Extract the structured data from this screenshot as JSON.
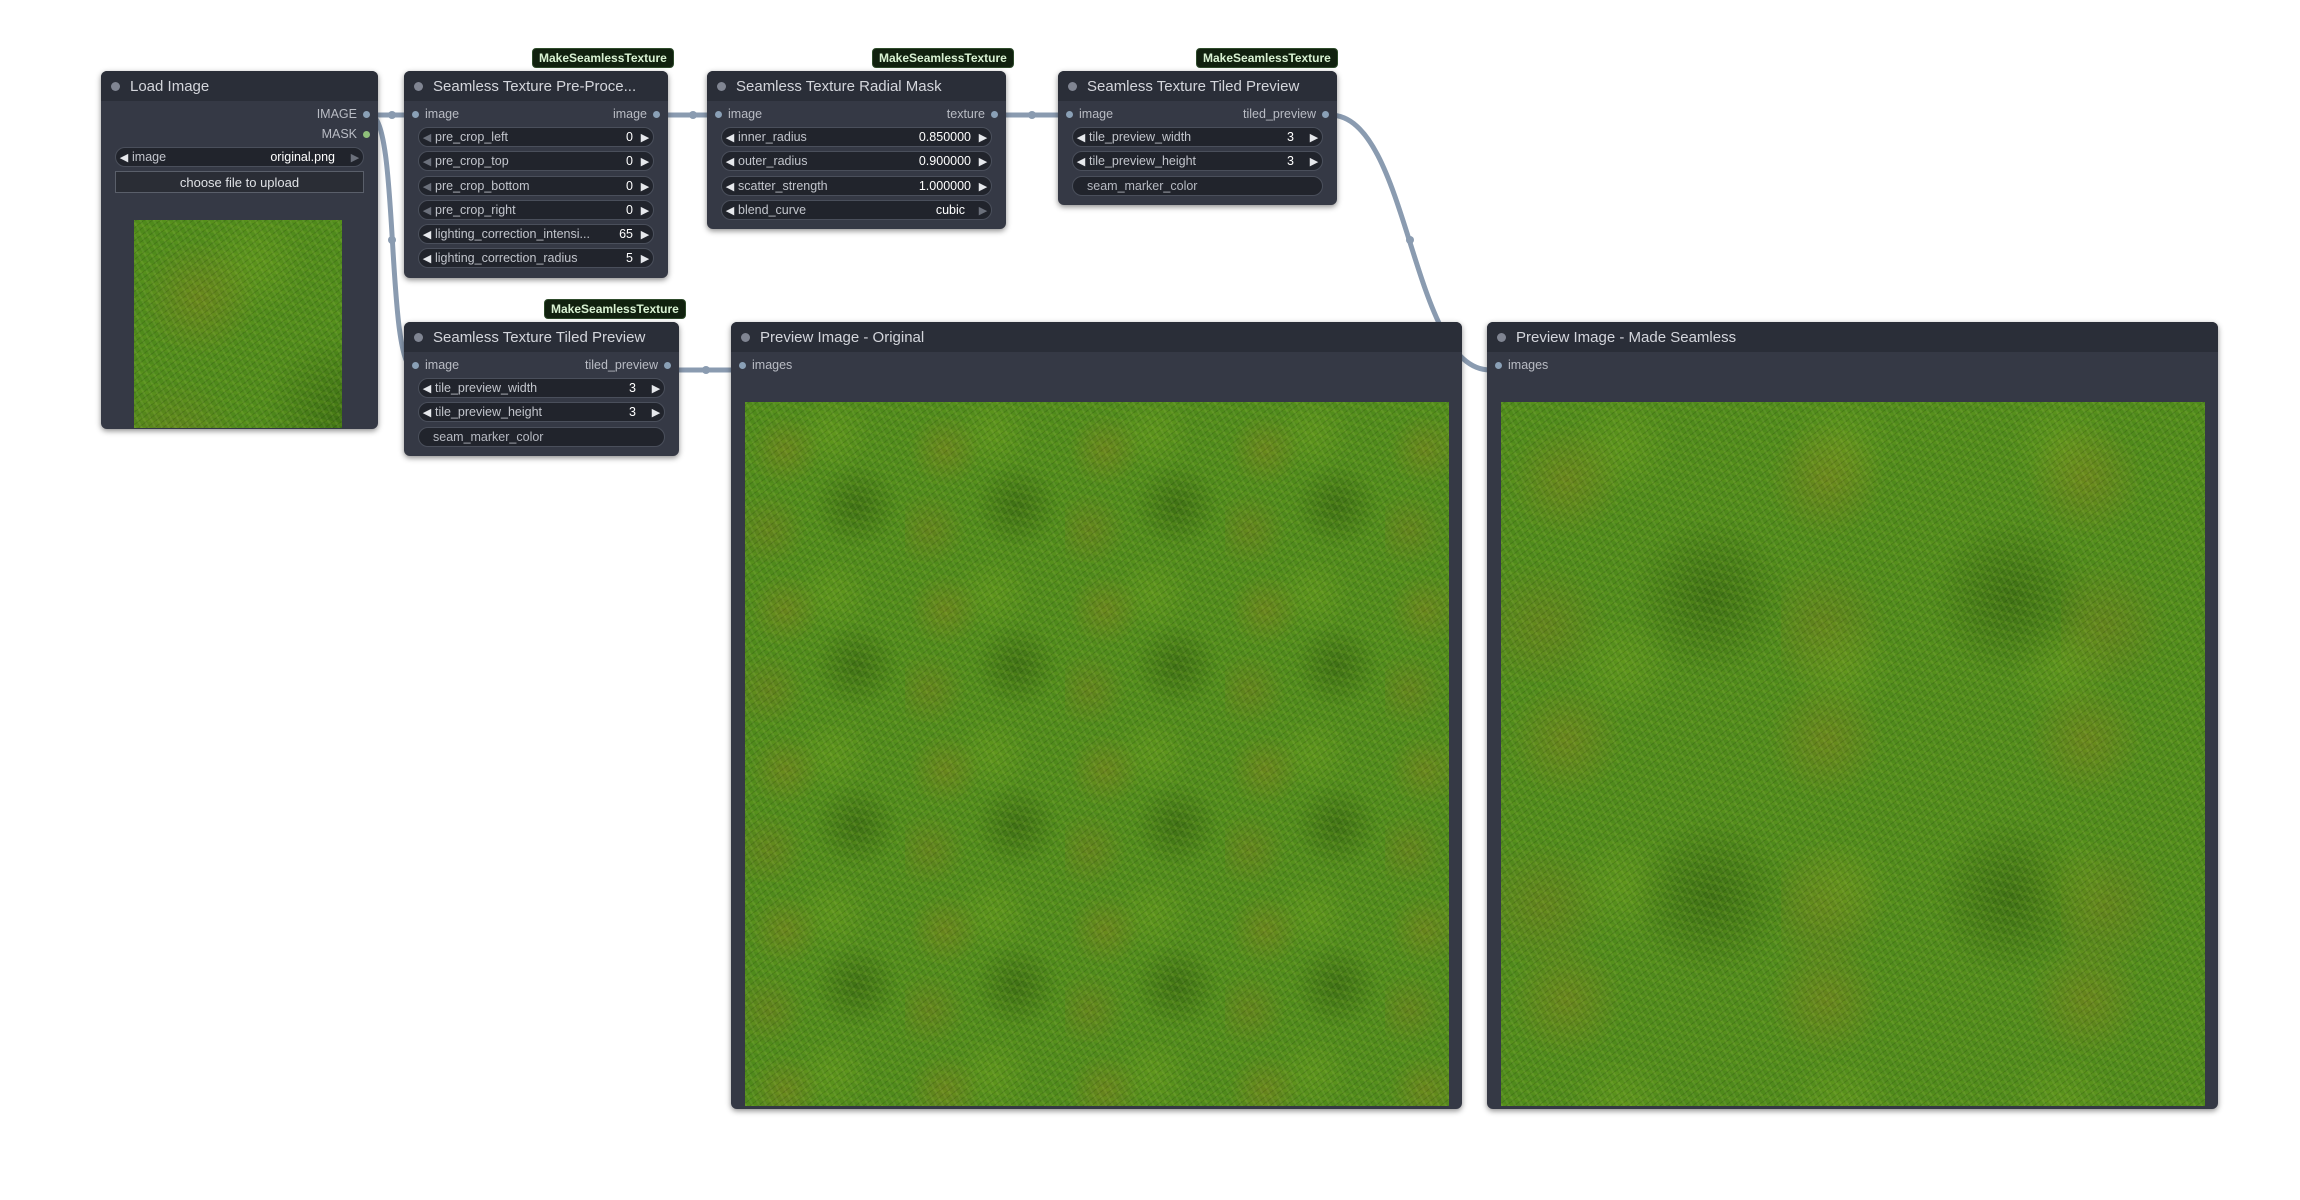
{
  "badge_text": "MakeSeamlessTexture",
  "colors": {
    "background": "#ffffff",
    "node_body": "#353945",
    "node_header": "#2a2e38",
    "wire": "#8a9bb0",
    "badge_bg": "#11210f"
  },
  "load_image": {
    "title": "Load Image",
    "outputs": [
      "IMAGE",
      "MASK"
    ],
    "image_widget": {
      "label": "image",
      "value": "original.png"
    },
    "upload_button": "choose file to upload"
  },
  "preprocess": {
    "title": "Seamless Texture Pre-Proce...",
    "input": "image",
    "output": "image",
    "widgets": [
      {
        "label": "pre_crop_left",
        "value": "0"
      },
      {
        "label": "pre_crop_top",
        "value": "0"
      },
      {
        "label": "pre_crop_bottom",
        "value": "0"
      },
      {
        "label": "pre_crop_right",
        "value": "0"
      },
      {
        "label": "lighting_correction_intensi...",
        "value": "65"
      },
      {
        "label": "lighting_correction_radius",
        "value": "5"
      }
    ]
  },
  "radial_mask": {
    "title": "Seamless Texture Radial Mask",
    "input": "image",
    "output": "texture",
    "widgets": [
      {
        "label": "inner_radius",
        "value": "0.850000"
      },
      {
        "label": "outer_radius",
        "value": "0.900000"
      },
      {
        "label": "scatter_strength",
        "value": "1.000000"
      },
      {
        "label": "blend_curve",
        "value": "cubic"
      }
    ]
  },
  "tiled_preview_top": {
    "title": "Seamless Texture Tiled Preview",
    "input": "image",
    "output": "tiled_preview",
    "widgets": [
      {
        "label": "tile_preview_width",
        "value": "3"
      },
      {
        "label": "tile_preview_height",
        "value": "3"
      }
    ],
    "text_widget": "seam_marker_color"
  },
  "tiled_preview_bottom": {
    "title": "Seamless Texture Tiled Preview",
    "input": "image",
    "output": "tiled_preview",
    "widgets": [
      {
        "label": "tile_preview_width",
        "value": "3"
      },
      {
        "label": "tile_preview_height",
        "value": "3"
      }
    ],
    "text_widget": "seam_marker_color"
  },
  "preview_original": {
    "title": "Preview Image - Original",
    "input": "images"
  },
  "preview_seamless": {
    "title": "Preview Image - Made Seamless",
    "input": "images"
  }
}
